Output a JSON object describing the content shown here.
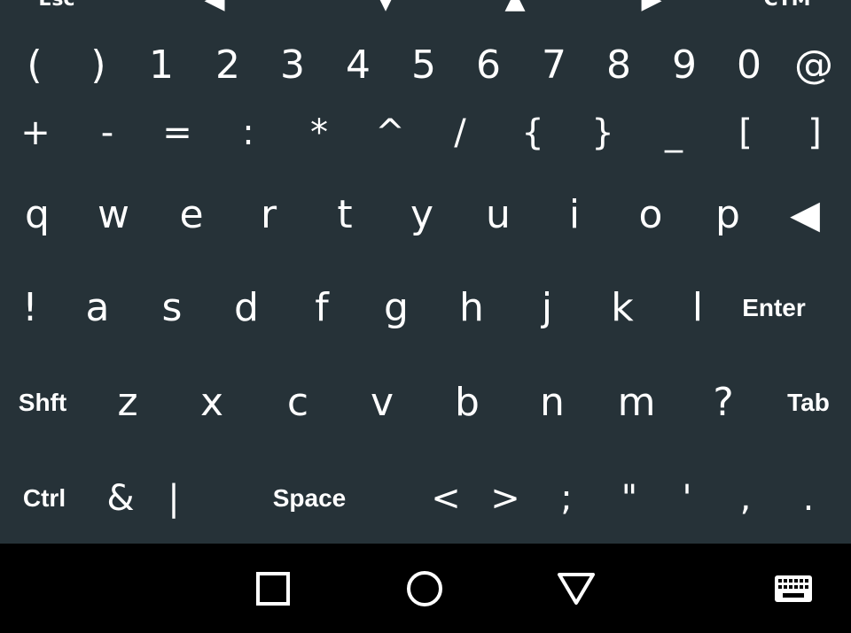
{
  "keyboard": {
    "function_row": [
      "Esc",
      "◀",
      "▼",
      "▲",
      "▶",
      "CTM"
    ],
    "row1": [
      "(",
      ")",
      "1",
      "2",
      "3",
      "4",
      "5",
      "6",
      "7",
      "8",
      "9",
      "0",
      "@"
    ],
    "row2": [
      "+",
      "-",
      "=",
      ":",
      "*",
      "^",
      "/",
      "{",
      "}",
      "_",
      "[",
      "]"
    ],
    "row3": [
      "q",
      "w",
      "e",
      "r",
      "t",
      "y",
      "u",
      "i",
      "o",
      "p",
      "◀"
    ],
    "row4": [
      "!",
      "a",
      "s",
      "d",
      "f",
      "g",
      "h",
      "j",
      "k",
      "l",
      "Enter"
    ],
    "row5": [
      "Shft",
      "z",
      "x",
      "c",
      "v",
      "b",
      "n",
      "m",
      "?",
      "Tab"
    ],
    "row6": [
      "Ctrl",
      "&",
      "|",
      "Space",
      "<",
      ">",
      ";",
      "\"",
      "'",
      ",",
      "."
    ]
  },
  "navbar": {
    "buttons": [
      "recent-apps",
      "home",
      "back",
      "keyboard"
    ]
  },
  "colors": {
    "keyboard_bg": "#263238",
    "navbar_bg": "#000000",
    "key_text": "#ffffff"
  }
}
